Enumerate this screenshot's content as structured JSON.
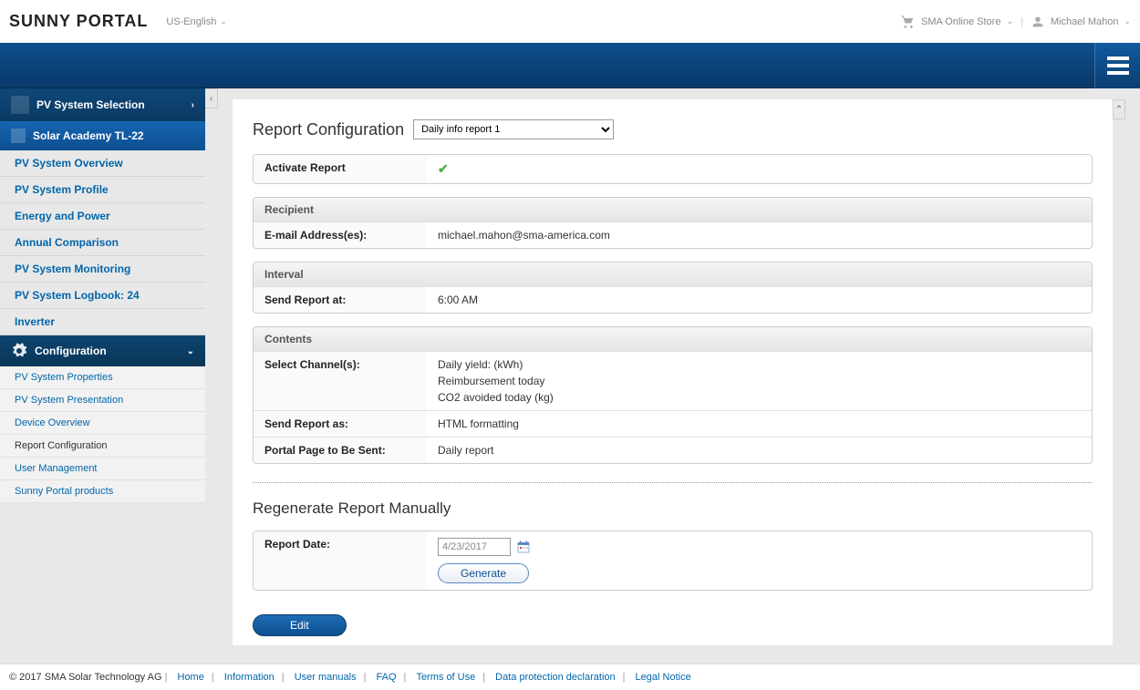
{
  "header": {
    "logo": "SUNNY PORTAL",
    "language": "US-English",
    "store": "SMA Online Store",
    "user": "Michael Mahon"
  },
  "sidebar": {
    "pv_selection": "PV System Selection",
    "selected_system": "Solar Academy TL-22",
    "nav": [
      "PV System Overview",
      "PV System Profile",
      "Energy and Power",
      "Annual Comparison",
      "PV System Monitoring",
      "PV System Logbook: 24",
      "Inverter"
    ],
    "config_header": "Configuration",
    "config_items": [
      "PV System Properties",
      "PV System Presentation",
      "Device Overview",
      "Report Configuration",
      "User Management",
      "Sunny Portal products"
    ]
  },
  "main": {
    "title": "Report Configuration",
    "report_select": "Daily info report 1",
    "activate_label": "Activate Report",
    "recipient_header": "Recipient",
    "email_label": "E-mail Address(es):",
    "email_value": "michael.mahon@sma-america.com",
    "interval_header": "Interval",
    "send_at_label": "Send Report at:",
    "send_at_value": "6:00 AM",
    "contents_header": "Contents",
    "channels_label": "Select Channel(s):",
    "channel1": "Daily yield: (kWh)",
    "channel2": "Reimbursement today",
    "channel3": "CO2 avoided today (kg)",
    "send_as_label": "Send Report as:",
    "send_as_value": "HTML formatting",
    "portal_page_label": "Portal Page to Be Sent:",
    "portal_page_value": "Daily report",
    "regen_title": "Regenerate Report Manually",
    "report_date_label": "Report Date:",
    "report_date_value": "4/23/2017",
    "generate_btn": "Generate",
    "edit_btn": "Edit"
  },
  "footer": {
    "copyright": "© 2017 SMA Solar Technology AG",
    "links": [
      "Home",
      "Information",
      "User manuals",
      "FAQ",
      "Terms of Use",
      "Data protection declaration",
      "Legal Notice"
    ]
  }
}
